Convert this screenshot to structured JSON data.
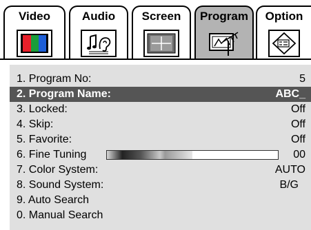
{
  "tabs": [
    {
      "label": "Video",
      "icon": "color-bars-icon",
      "active": false
    },
    {
      "label": "Audio",
      "icon": "music-note-ear-icon",
      "active": false
    },
    {
      "label": "Screen",
      "icon": "screen-cross-icon",
      "active": false
    },
    {
      "label": "Program",
      "icon": "antenna-tv-icon",
      "active": true
    },
    {
      "label": "Option",
      "icon": "settings-diamond-icon",
      "active": false
    }
  ],
  "menu": {
    "items": [
      {
        "label": "1. Program No:",
        "value": "5"
      },
      {
        "label": "2. Program Name:",
        "value": "ABC_",
        "selected": true
      },
      {
        "label": "3. Locked:",
        "value": "Off"
      },
      {
        "label": "4. Skip:",
        "value": "Off"
      },
      {
        "label": "5. Favorite:",
        "value": "Off"
      },
      {
        "label": "6. Fine Tuning",
        "value": "00"
      },
      {
        "label": "7. Color System:",
        "value": "AUTO"
      },
      {
        "label": "8. Sound System:",
        "value": "B/G"
      },
      {
        "label": "9. Auto Search",
        "value": ""
      },
      {
        "label": "0. Manual Search",
        "value": ""
      }
    ],
    "fine_tuning_level": 0.5
  },
  "colors": {
    "active_tab": "#b3b3b3",
    "selected_row": "#555555",
    "panel": "#e0e0e0"
  }
}
